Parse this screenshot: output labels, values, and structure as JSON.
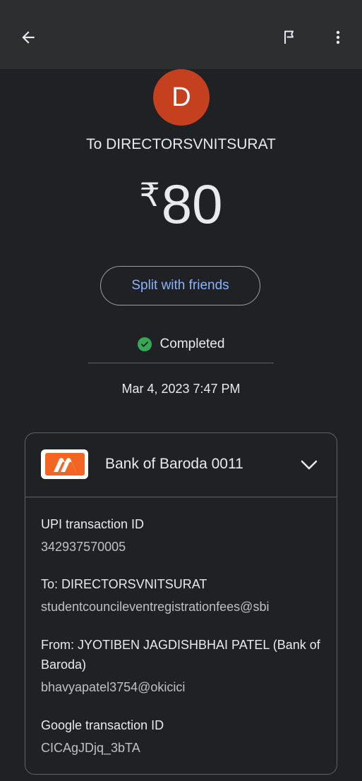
{
  "payee": {
    "avatar_letter": "D",
    "to_label": "To DIRECTORSVNITSURAT"
  },
  "amount": {
    "currency": "₹",
    "value": "80"
  },
  "split_button": "Split with friends",
  "status": {
    "text": "Completed",
    "color": "#34a853"
  },
  "datetime": "Mar 4, 2023 7:47 PM",
  "account": {
    "bank_name": "Bank of Baroda 0011",
    "logo_color": "#f26522"
  },
  "details": [
    {
      "label": "UPI transaction ID",
      "value": "342937570005"
    },
    {
      "label": "To: DIRECTORSVNITSURAT",
      "value": "studentcouncileventregistrationfees@sbi"
    },
    {
      "label": "From: JYOTIBEN JAGDISHBHAI PATEL (Bank of Baroda)",
      "value": "bhavyapatel3754@okicici"
    },
    {
      "label": "Google transaction ID",
      "value": "CICAgJDjq_3bTA"
    }
  ],
  "icons": {
    "back": "arrow-left-icon",
    "report": "flag-icon",
    "more": "more-vert-icon",
    "expand": "chevron-down-icon",
    "status": "check-circle-icon"
  },
  "colors": {
    "background": "#202124",
    "topbar": "#2d2e30",
    "avatar": "#c5401f",
    "accent_link": "#8ab4f8"
  }
}
